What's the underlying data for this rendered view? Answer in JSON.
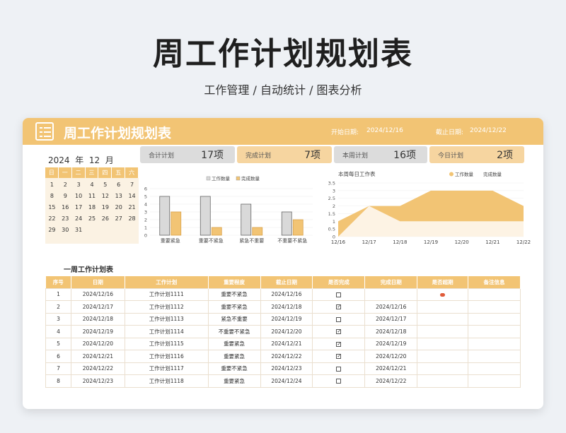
{
  "hero": {
    "title": "周工作计划规划表",
    "subtitle": "工作管理 / 自动统计 / 图表分析"
  },
  "banner": {
    "title": "周工作计划规划表",
    "start_label": "开始日期:",
    "start_value": "2024/12/16",
    "end_label": "截止日期:",
    "end_value": "2024/12/22"
  },
  "kpis": [
    {
      "label": "合计计划",
      "value": "17项"
    },
    {
      "label": "完成计划",
      "value": "7项"
    },
    {
      "label": "本周计划",
      "value": "16项"
    },
    {
      "label": "今日计划",
      "value": "2项"
    }
  ],
  "calendar": {
    "year": "2024",
    "year_unit": "年",
    "month": "12",
    "month_unit": "月",
    "weekdays": [
      "日",
      "一",
      "二",
      "三",
      "四",
      "五",
      "六"
    ],
    "weeks": [
      [
        "1",
        "2",
        "3",
        "4",
        "5",
        "6",
        "7"
      ],
      [
        "8",
        "9",
        "10",
        "11",
        "12",
        "13",
        "14"
      ],
      [
        "15",
        "16",
        "17",
        "18",
        "19",
        "20",
        "21"
      ],
      [
        "22",
        "23",
        "24",
        "25",
        "26",
        "27",
        "28"
      ],
      [
        "29",
        "30",
        "31",
        "",
        "",
        "",
        ""
      ]
    ]
  },
  "chart_data": [
    {
      "type": "bar",
      "categories": [
        "重要紧急",
        "重要不紧急",
        "紧急不重要",
        "不重要不紧急"
      ],
      "series": [
        {
          "name": "工作数量",
          "values": [
            5,
            5,
            4,
            3
          ],
          "color": "#d9d9d9"
        },
        {
          "name": "完成数量",
          "values": [
            3,
            1,
            1,
            2
          ],
          "color": "#f2c474"
        }
      ],
      "yticks": [
        "0",
        "1",
        "2",
        "3",
        "4",
        "5",
        "6"
      ],
      "ylim": [
        0,
        6
      ],
      "legend": "top"
    },
    {
      "type": "area",
      "title": "本周每日工作表",
      "x": [
        "12/16",
        "12/17",
        "12/18",
        "12/19",
        "12/20",
        "12/21",
        "12/22"
      ],
      "series": [
        {
          "name": "工作数量",
          "values": [
            1,
            2,
            2,
            3,
            3,
            3,
            2
          ],
          "color": "#f2c474"
        },
        {
          "name": "完成数量",
          "values": [
            0,
            2,
            1,
            1,
            1,
            1,
            1
          ],
          "color": "#fdf3e4"
        }
      ],
      "yticks": [
        "0",
        "0.5",
        "1",
        "1.5",
        "2",
        "2.5",
        "3",
        "3.5"
      ],
      "ylim": [
        0,
        3.5
      ],
      "legend": "top-right"
    }
  ],
  "table": {
    "section_title": "一周工作计划表",
    "headers": [
      "序号",
      "日期",
      "工作计划",
      "重要程度",
      "截止日期",
      "是否完成",
      "完成日期",
      "是否超期",
      "备注信息"
    ],
    "rows": [
      [
        "1",
        "2024/12/16",
        "工作计划1111",
        "重要不紧急",
        "2024/12/16",
        "□",
        "",
        "overdue",
        ""
      ],
      [
        "2",
        "2024/12/17",
        "工作计划1112",
        "重要不紧急",
        "2024/12/18",
        "☑",
        "2024/12/16",
        "",
        ""
      ],
      [
        "3",
        "2024/12/18",
        "工作计划1113",
        "紧急不重要",
        "2024/12/19",
        "☐",
        "2024/12/17",
        "",
        ""
      ],
      [
        "4",
        "2024/12/19",
        "工作计划1114",
        "不重要不紧急",
        "2024/12/20",
        "☑",
        "2024/12/18",
        "",
        ""
      ],
      [
        "5",
        "2024/12/20",
        "工作计划1115",
        "重要紧急",
        "2024/12/21",
        "☑",
        "2024/12/19",
        "",
        ""
      ],
      [
        "6",
        "2024/12/21",
        "工作计划1116",
        "重要紧急",
        "2024/12/22",
        "☑",
        "2024/12/20",
        "",
        ""
      ],
      [
        "7",
        "2024/12/22",
        "工作计划1117",
        "重要不紧急",
        "2024/12/23",
        "☐",
        "2024/12/21",
        "",
        ""
      ],
      [
        "8",
        "2024/12/23",
        "工作计划1118",
        "重要紧急",
        "2024/12/24",
        "☐",
        "2024/12/22",
        "",
        ""
      ]
    ]
  },
  "colors": {
    "accent": "#f2c474",
    "accent_light": "#fbf2e3",
    "bar_gray": "#d9d9d9",
    "overdue": "#e05b3a"
  }
}
